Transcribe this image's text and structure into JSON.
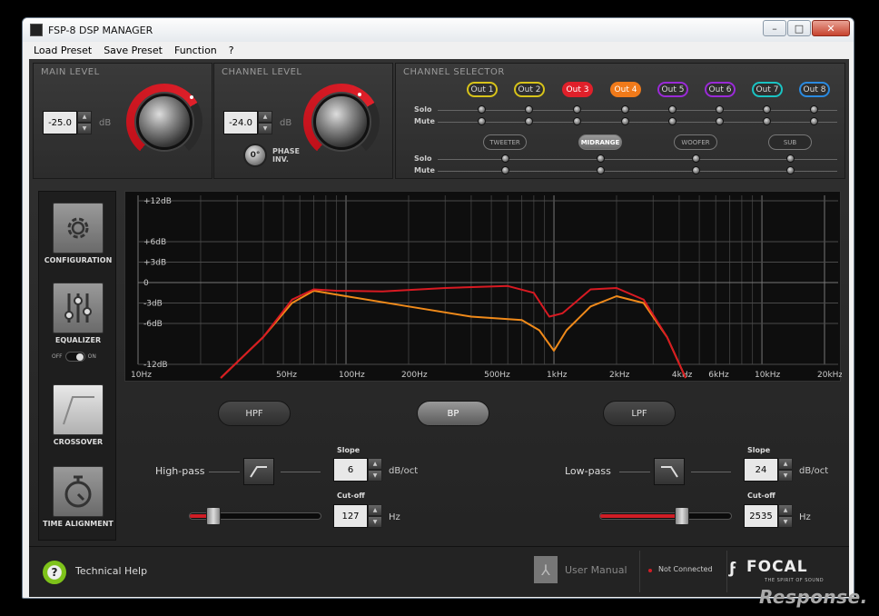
{
  "window": {
    "title": "FSP-8 DSP MANAGER",
    "btn_min": "–",
    "btn_max": "□",
    "btn_close": "✕"
  },
  "menu": [
    "Load Preset",
    "Save Preset",
    "Function",
    "?"
  ],
  "main_level": {
    "label": "MAIN LEVEL",
    "value": "-25.0",
    "unit": "dB"
  },
  "channel_level": {
    "label": "CHANNEL LEVEL",
    "value": "-24.0",
    "unit": "dB",
    "phase_value": "0°",
    "phase_label_1": "PHASE",
    "phase_label_2": "INV."
  },
  "channel_selector": {
    "label": "CHANNEL SELECTOR",
    "outputs": [
      {
        "name": "Out 1",
        "color": "#d7c31a"
      },
      {
        "name": "Out 2",
        "color": "#d7c31a"
      },
      {
        "name": "Out 3",
        "color": "#e0202a"
      },
      {
        "name": "Out 4",
        "color": "#f07a1a"
      },
      {
        "name": "Out 5",
        "color": "#9a2ad7"
      },
      {
        "name": "Out 6",
        "color": "#9a2ad7"
      },
      {
        "name": "Out 7",
        "color": "#1ac3c3"
      },
      {
        "name": "Out 8",
        "color": "#2a8ae0"
      }
    ],
    "solo_label": "Solo",
    "mute_label": "Mute",
    "groups": [
      "TWEETER",
      "MIDRANGE",
      "WOOFER",
      "SUB"
    ],
    "active_group": "MIDRANGE"
  },
  "sidebar": {
    "items": [
      {
        "label": "CONFIGURATION",
        "icon": "gear-icon"
      },
      {
        "label": "EQUALIZER",
        "icon": "sliders-icon"
      },
      {
        "label": "CROSSOVER",
        "icon": "crossover-icon"
      },
      {
        "label": "TIME ALIGNMENT",
        "icon": "stopwatch-icon"
      }
    ],
    "toggle_off": "OFF",
    "toggle_on": "ON",
    "active": "CROSSOVER"
  },
  "graph": {
    "y_labels": [
      {
        "text": "+12dB",
        "db": 12
      },
      {
        "text": "+6dB",
        "db": 6
      },
      {
        "text": "+3dB",
        "db": 3
      },
      {
        "text": "0",
        "db": 0
      },
      {
        "text": "-3dB",
        "db": -3
      },
      {
        "text": "-6dB",
        "db": -6
      },
      {
        "text": "-12dB",
        "db": -12
      }
    ],
    "x_labels": [
      {
        "text": "10Hz",
        "hz": 10
      },
      {
        "text": "50Hz",
        "hz": 50
      },
      {
        "text": "100Hz",
        "hz": 100
      },
      {
        "text": "200Hz",
        "hz": 200
      },
      {
        "text": "500Hz",
        "hz": 500
      },
      {
        "text": "1kHz",
        "hz": 1000
      },
      {
        "text": "2kHz",
        "hz": 2000
      },
      {
        "text": "4kHz",
        "hz": 4000
      },
      {
        "text": "6kHz",
        "hz": 6000
      },
      {
        "text": "10kHz",
        "hz": 10000
      },
      {
        "text": "20kHz",
        "hz": 20000
      }
    ],
    "red_curve": [
      [
        25,
        -14
      ],
      [
        40,
        -8
      ],
      [
        55,
        -2.5
      ],
      [
        70,
        -1
      ],
      [
        90,
        -1.2
      ],
      [
        150,
        -1.3
      ],
      [
        300,
        -0.8
      ],
      [
        600,
        -0.5
      ],
      [
        800,
        -1.5
      ],
      [
        950,
        -5
      ],
      [
        1100,
        -4.5
      ],
      [
        1500,
        -1
      ],
      [
        2000,
        -0.8
      ],
      [
        2700,
        -2.5
      ],
      [
        3500,
        -8
      ],
      [
        4300,
        -14
      ]
    ],
    "orange_curve": [
      [
        25,
        -14
      ],
      [
        40,
        -8
      ],
      [
        55,
        -3
      ],
      [
        70,
        -1.2
      ],
      [
        100,
        -2
      ],
      [
        200,
        -3.5
      ],
      [
        400,
        -5
      ],
      [
        700,
        -5.5
      ],
      [
        850,
        -7
      ],
      [
        1000,
        -10
      ],
      [
        1150,
        -7
      ],
      [
        1500,
        -3.5
      ],
      [
        2000,
        -2
      ],
      [
        2700,
        -3
      ],
      [
        3500,
        -8
      ],
      [
        4300,
        -14
      ]
    ]
  },
  "crossover": {
    "modes": [
      "HPF",
      "BP",
      "LPF"
    ],
    "active_mode": "BP",
    "highpass": {
      "label": "High-pass",
      "slope_label": "Slope",
      "slope": "6",
      "slope_unit": "dB/oct",
      "cutoff_label": "Cut-off",
      "cutoff": "127",
      "cutoff_unit": "Hz"
    },
    "lowpass": {
      "label": "Low-pass",
      "slope_label": "Slope",
      "slope": "24",
      "slope_unit": "dB/oct",
      "cutoff_label": "Cut-off",
      "cutoff": "2535",
      "cutoff_unit": "Hz"
    }
  },
  "footer": {
    "help": "Technical Help",
    "help_icon": "?",
    "manual": "User Manual",
    "status": "Not Connected",
    "brand": "FOCAL",
    "brand_tagline": "THE SPIRIT OF SOUND"
  },
  "watermark": "Response."
}
